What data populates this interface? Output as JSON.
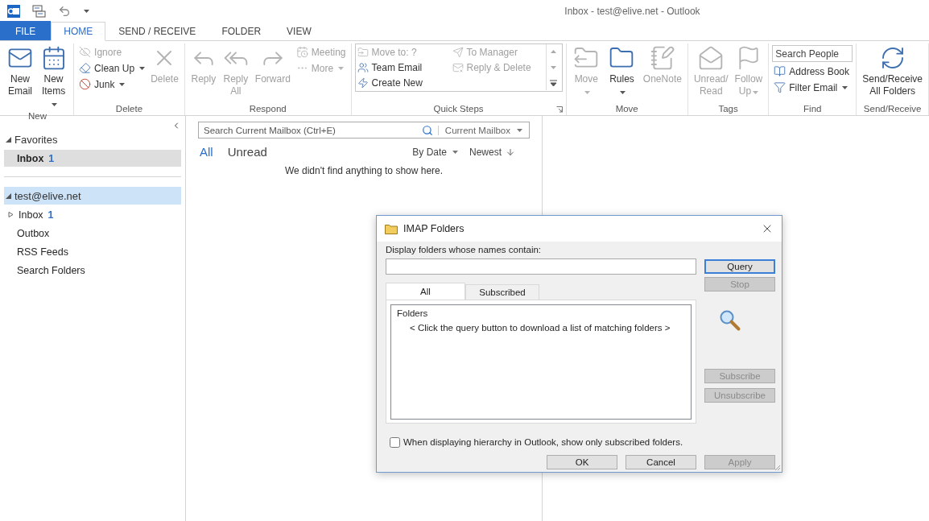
{
  "window": {
    "title": "Inbox - test@elive.net - Outlook"
  },
  "ribbon": {
    "tabs": [
      {
        "label": "FILE",
        "kind": "file",
        "selected": false
      },
      {
        "label": "HOME",
        "kind": "tab",
        "selected": true
      },
      {
        "label": "SEND / RECEIVE",
        "kind": "tab",
        "selected": false
      },
      {
        "label": "FOLDER",
        "kind": "tab",
        "selected": false
      },
      {
        "label": "VIEW",
        "kind": "tab",
        "selected": false
      }
    ],
    "groups": [
      {
        "label": "New",
        "items": [
          {
            "kind": "large",
            "label": "New\nEmail",
            "disabled": false
          },
          {
            "kind": "large",
            "label": "New\nItems",
            "disabled": false,
            "dropdown": true
          }
        ]
      },
      {
        "label": "Delete",
        "items": [
          {
            "kind": "small",
            "label": "Ignore",
            "disabled": true
          },
          {
            "kind": "small",
            "label": "Clean Up",
            "disabled": false,
            "dropdown": true
          },
          {
            "kind": "small",
            "label": "Junk",
            "disabled": false,
            "dropdown": true
          },
          {
            "kind": "large",
            "label": "Delete",
            "disabled": true
          }
        ]
      },
      {
        "label": "Respond",
        "items": [
          {
            "kind": "large",
            "label": "Reply",
            "disabled": true
          },
          {
            "kind": "large",
            "label": "Reply\nAll",
            "disabled": true
          },
          {
            "kind": "large",
            "label": "Forward",
            "disabled": true
          },
          {
            "kind": "small",
            "label": "Meeting",
            "disabled": true
          },
          {
            "kind": "small",
            "label": "More",
            "disabled": true,
            "dropdown": true
          }
        ]
      },
      {
        "label": "Quick Steps",
        "launcher": true,
        "items": [
          {
            "kind": "quick",
            "label": "Move to: ?",
            "disabled": true
          },
          {
            "kind": "quick",
            "label": "To Manager",
            "disabled": true
          },
          {
            "kind": "quick",
            "label": "Team Email",
            "disabled": false
          },
          {
            "kind": "quick",
            "label": "Reply & Delete",
            "disabled": true
          },
          {
            "kind": "quick",
            "label": "Create New",
            "disabled": false
          }
        ]
      },
      {
        "label": "Move",
        "items": [
          {
            "kind": "large",
            "label": "Move",
            "disabled": true,
            "dropdown": true
          },
          {
            "kind": "large",
            "label": "Rules",
            "disabled": false,
            "dropdown": true
          },
          {
            "kind": "large",
            "label": "OneNote",
            "disabled": true
          }
        ]
      },
      {
        "label": "Tags",
        "items": [
          {
            "kind": "large",
            "label": "Unread/\nRead",
            "disabled": true
          },
          {
            "kind": "large",
            "label": "Follow\nUp",
            "disabled": true,
            "dropdown": true
          }
        ]
      },
      {
        "label": "Find",
        "items": [
          {
            "kind": "search",
            "placeholder": "Search People"
          },
          {
            "kind": "small",
            "label": "Address Book",
            "disabled": false
          },
          {
            "kind": "small",
            "label": "Filter Email",
            "disabled": false,
            "dropdown": true
          }
        ]
      },
      {
        "label": "Send/Receive",
        "items": [
          {
            "kind": "large",
            "label": "Send/Receive\nAll Folders",
            "disabled": false
          }
        ]
      }
    ]
  },
  "sidebar": {
    "sections": [
      {
        "label": "Favorites",
        "expanded": true,
        "selected": false,
        "children": [
          {
            "label": "Inbox",
            "count": "1",
            "kind": "leaf",
            "selected": true
          }
        ]
      },
      {
        "label": "test@elive.net",
        "expanded": true,
        "selected": true,
        "children": [
          {
            "label": "Inbox",
            "count": "1",
            "kind": "node",
            "expanded": false,
            "selected": false
          },
          {
            "label": "Outbox",
            "kind": "leaf",
            "selected": false
          },
          {
            "label": "RSS Feeds",
            "kind": "leaf",
            "selected": false
          },
          {
            "label": "Search Folders",
            "kind": "leaf",
            "selected": false
          }
        ]
      }
    ]
  },
  "mail_list": {
    "search": {
      "placeholder": "Search Current Mailbox (Ctrl+E)",
      "scope": "Current Mailbox"
    },
    "filters": [
      {
        "label": "All",
        "selected": true
      },
      {
        "label": "Unread",
        "selected": false
      }
    ],
    "sort": "By Date",
    "order": "Newest",
    "empty_message": "We didn't find anything to show here."
  },
  "dialog": {
    "title": "IMAP Folders",
    "prompt": "Display folders whose names contain:",
    "tabs": [
      {
        "label": "All",
        "selected": true
      },
      {
        "label": "Subscribed",
        "selected": false
      }
    ],
    "list_header": "Folders",
    "list_message": "< Click the query button to download a list of matching folders >",
    "side_buttons": [
      {
        "label": "Query",
        "disabled": false,
        "default": true
      },
      {
        "label": "Stop",
        "disabled": true,
        "default": false
      },
      {
        "label": "Subscribe",
        "disabled": true,
        "default": false
      },
      {
        "label": "Unsubscribe",
        "disabled": true,
        "default": false
      }
    ],
    "checkbox": {
      "label": "When displaying hierarchy in Outlook, show only subscribed folders.",
      "checked": false
    },
    "buttons": [
      {
        "label": "OK",
        "disabled": false
      },
      {
        "label": "Cancel",
        "disabled": false
      },
      {
        "label": "Apply",
        "disabled": true
      }
    ]
  }
}
